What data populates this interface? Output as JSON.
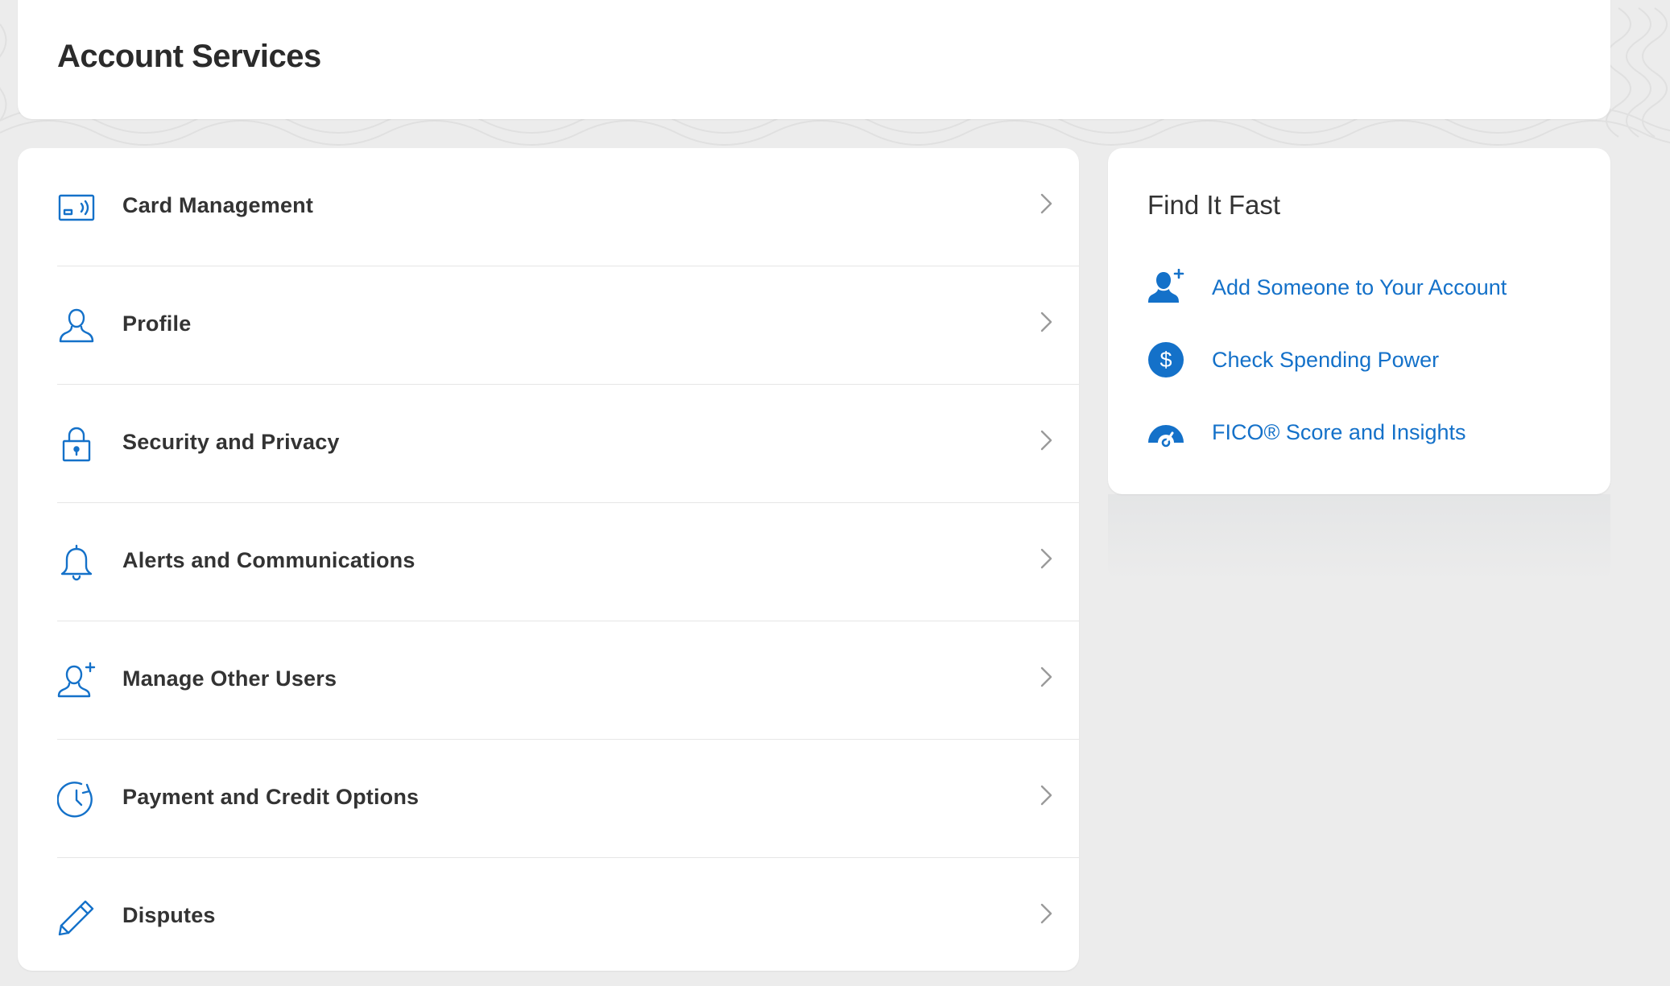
{
  "page": {
    "title": "Account Services"
  },
  "menu": {
    "items": [
      {
        "label": "Card Management",
        "icon": "card-contactless-icon"
      },
      {
        "label": "Profile",
        "icon": "person-icon"
      },
      {
        "label": "Security and Privacy",
        "icon": "lock-icon"
      },
      {
        "label": "Alerts and Communications",
        "icon": "bell-icon"
      },
      {
        "label": "Manage Other Users",
        "icon": "person-add-icon"
      },
      {
        "label": "Payment and Credit Options",
        "icon": "clock-refresh-icon"
      },
      {
        "label": "Disputes",
        "icon": "pencil-icon"
      }
    ]
  },
  "find_it_fast": {
    "title": "Find It Fast",
    "links": [
      {
        "label": "Add Someone to Your Account",
        "icon": "person-add-filled-icon"
      },
      {
        "label": "Check Spending Power",
        "icon": "dollar-circle-icon"
      },
      {
        "label": "FICO® Score and Insights",
        "icon": "gauge-icon"
      }
    ]
  },
  "colors": {
    "accent": "#1471c9",
    "text": "#333333",
    "background": "#ececec",
    "card": "#ffffff",
    "divider": "#e6e6e6"
  }
}
